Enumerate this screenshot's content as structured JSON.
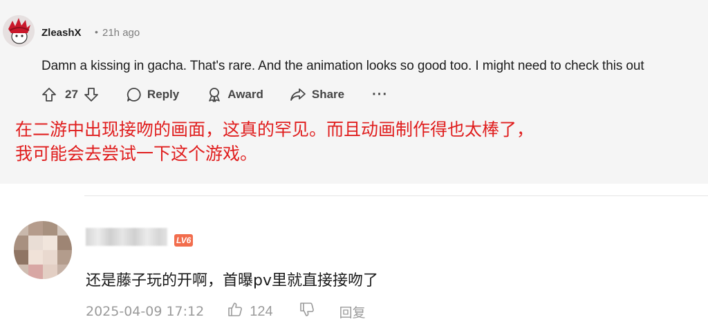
{
  "reddit": {
    "username": "ZleashX",
    "separator": "•",
    "time": "21h ago",
    "body": "Damn a kissing in gacha. That's rare. And the animation looks so good too. I might need to check this out",
    "vote_count": "27",
    "reply_label": "Reply",
    "award_label": "Award",
    "share_label": "Share",
    "more_label": "···",
    "translation_line1": "在二游中出现接吻的画面，这真的罕见。而且动画制作得也太棒了，",
    "translation_line2": "我可能会去尝试一下这个游戏。"
  },
  "cn_comment": {
    "level": "LV6",
    "body": "还是藤子玩的开啊，首曝pv里就直接接吻了",
    "date": "2025-04-09 17:12",
    "like_count": "124",
    "reply_label": "回复"
  },
  "colors": {
    "translation": "#e01d1d",
    "level_badge": "#f26d4d",
    "panel_bg": "#f5f5f5"
  },
  "icons": [
    "snoo-avatar-icon",
    "upvote-icon",
    "downvote-icon",
    "comment-icon",
    "award-icon",
    "share-icon",
    "more-icon",
    "thumbs-up-icon",
    "thumbs-down-icon"
  ]
}
